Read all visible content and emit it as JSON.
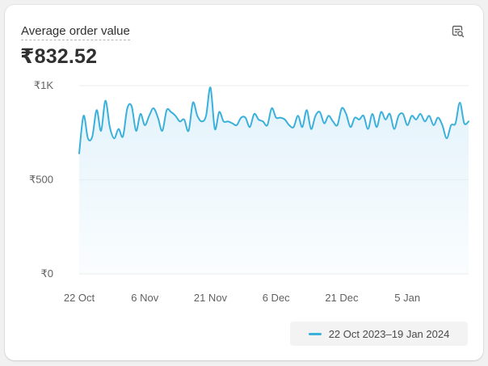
{
  "card": {
    "title": "Average order value",
    "value": "₹832.52",
    "explore_icon": "search-data-icon"
  },
  "legend": {
    "label": "22 Oct 2023–19 Jan 2024"
  },
  "colors": {
    "line": "#3bb0db",
    "area": "#dff1fa",
    "grid": "#ebebeb",
    "text": "#303030",
    "axis_text": "#616161"
  },
  "chart_data": {
    "type": "line",
    "title": "Average order value",
    "xlabel": "",
    "ylabel": "",
    "ylim": [
      0,
      1000
    ],
    "y_ticks": [
      0,
      500,
      1000
    ],
    "y_tick_labels": [
      "₹0",
      "₹500",
      "₹1K"
    ],
    "x_tick_labels": [
      "22 Oct",
      "6 Nov",
      "21 Nov",
      "6 Dec",
      "21 Dec",
      "5 Jan"
    ],
    "x_tick_dates": [
      "2023-10-22",
      "2023-11-06",
      "2023-11-21",
      "2023-12-06",
      "2023-12-21",
      "2024-01-05"
    ],
    "grid": true,
    "legend_position": "bottom-right",
    "series": [
      {
        "name": "22 Oct 2023–19 Jan 2024",
        "x": [
          "2023-10-22",
          "2023-10-23",
          "2023-10-24",
          "2023-10-25",
          "2023-10-26",
          "2023-10-27",
          "2023-10-28",
          "2023-10-29",
          "2023-10-30",
          "2023-10-31",
          "2023-11-01",
          "2023-11-02",
          "2023-11-03",
          "2023-11-04",
          "2023-11-05",
          "2023-11-06",
          "2023-11-07",
          "2023-11-08",
          "2023-11-09",
          "2023-11-10",
          "2023-11-11",
          "2023-11-12",
          "2023-11-13",
          "2023-11-14",
          "2023-11-15",
          "2023-11-16",
          "2023-11-17",
          "2023-11-18",
          "2023-11-19",
          "2023-11-20",
          "2023-11-21",
          "2023-11-22",
          "2023-11-23",
          "2023-11-24",
          "2023-11-25",
          "2023-11-26",
          "2023-11-27",
          "2023-11-28",
          "2023-11-29",
          "2023-11-30",
          "2023-12-01",
          "2023-12-02",
          "2023-12-03",
          "2023-12-04",
          "2023-12-05",
          "2023-12-06",
          "2023-12-07",
          "2023-12-08",
          "2023-12-09",
          "2023-12-10",
          "2023-12-11",
          "2023-12-12",
          "2023-12-13",
          "2023-12-14",
          "2023-12-15",
          "2023-12-16",
          "2023-12-17",
          "2023-12-18",
          "2023-12-19",
          "2023-12-20",
          "2023-12-21",
          "2023-12-22",
          "2023-12-23",
          "2023-12-24",
          "2023-12-25",
          "2023-12-26",
          "2023-12-27",
          "2023-12-28",
          "2023-12-29",
          "2023-12-30",
          "2023-12-31",
          "2024-01-01",
          "2024-01-02",
          "2024-01-03",
          "2024-01-04",
          "2024-01-05",
          "2024-01-06",
          "2024-01-07",
          "2024-01-08",
          "2024-01-09",
          "2024-01-10",
          "2024-01-11",
          "2024-01-12",
          "2024-01-13",
          "2024-01-14",
          "2024-01-15",
          "2024-01-16",
          "2024-01-17",
          "2024-01-18",
          "2024-01-19"
        ],
        "values": [
          640,
          840,
          720,
          730,
          870,
          760,
          920,
          780,
          720,
          770,
          730,
          880,
          890,
          760,
          850,
          790,
          840,
          880,
          830,
          760,
          870,
          860,
          840,
          810,
          820,
          760,
          910,
          840,
          810,
          840,
          990,
          770,
          860,
          810,
          810,
          800,
          790,
          830,
          830,
          780,
          850,
          820,
          810,
          790,
          880,
          830,
          830,
          820,
          790,
          780,
          840,
          780,
          870,
          770,
          840,
          860,
          800,
          840,
          810,
          790,
          880,
          850,
          780,
          830,
          820,
          840,
          770,
          850,
          780,
          860,
          820,
          850,
          770,
          840,
          850,
          790,
          840,
          820,
          850,
          810,
          840,
          790,
          830,
          790,
          720,
          790,
          800,
          910,
          800,
          810
        ]
      }
    ]
  }
}
